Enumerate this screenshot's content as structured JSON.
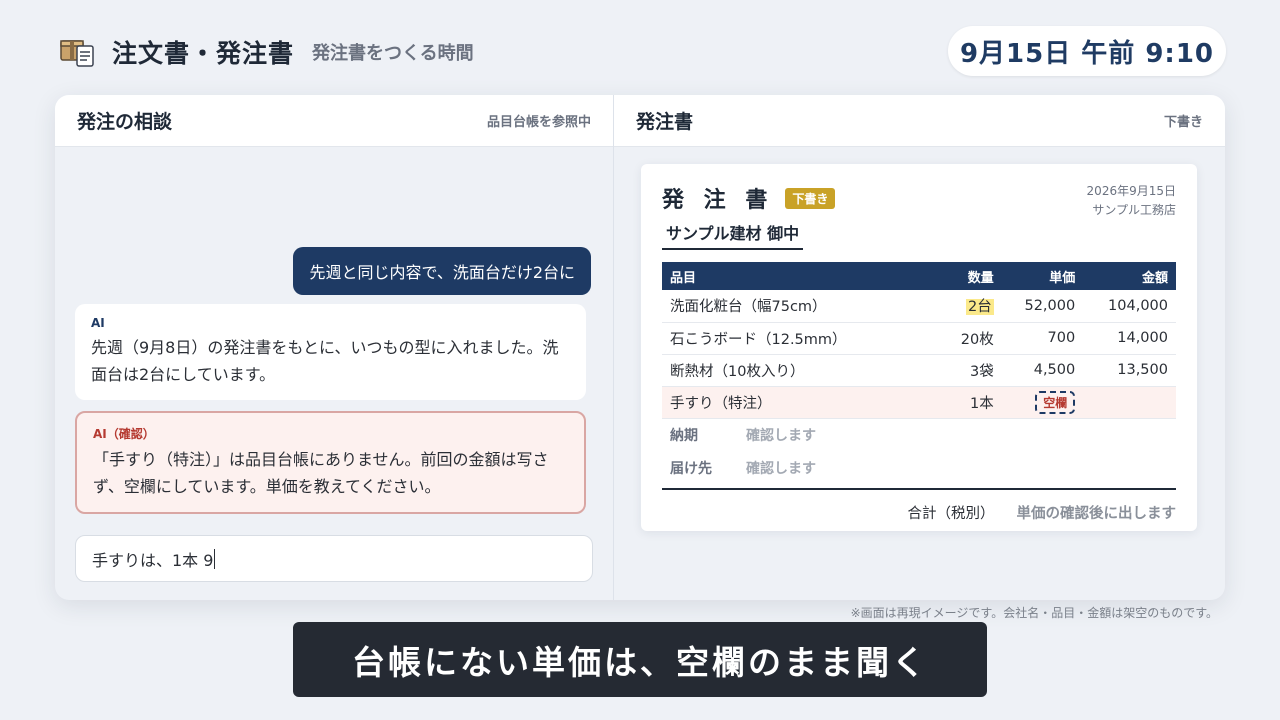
{
  "header": {
    "title": "注文書・発注書",
    "subtitle": "発注書をつくる時間",
    "clock": "9月15日 午前 9:10",
    "icon": "box-document-icon"
  },
  "chat_pane": {
    "title": "発注の相談",
    "hint": "品目台帳を参照中",
    "user_message": "先週と同じ内容で、洗面台だけ2台に",
    "ai_message": {
      "tag": "AI",
      "text": "先週（9月8日）の発注書をもとに、いつもの型に入れました。洗面台は2台にしています。"
    },
    "ai_confirm": {
      "tag": "AI（確認）",
      "text": "「手すり（特注）」は品目台帳にありません。前回の金額は写さず、空欄にしています。単価を教えてください。"
    },
    "input_value": "手すりは、1本 9"
  },
  "doc_pane": {
    "title": "発注書",
    "hint": "下書き",
    "doc": {
      "title": "発 注 書",
      "badge": "下書き",
      "recipient": "サンプル建材 御中",
      "date": "2026年9月15日",
      "issuer": "サンプル工務店",
      "columns": [
        "品目",
        "数量",
        "単価",
        "金額"
      ],
      "rows": [
        {
          "item": "洗面化粧台（幅75cm）",
          "qty": "2台",
          "price": "52,000",
          "amount": "104,000"
        },
        {
          "item": "石こうボード（12.5mm）",
          "qty": "20枚",
          "price": "700",
          "amount": "14,000"
        },
        {
          "item": "断熱材（10枚入り）",
          "qty": "3袋",
          "price": "4,500",
          "amount": "13,500"
        },
        {
          "item": "手すり（特注）",
          "qty": "1本",
          "price": "空欄",
          "amount": ""
        }
      ],
      "delivery_label": "納期",
      "delivery_value": "確認します",
      "destination_label": "届け先",
      "destination_value": "確認します",
      "total_label": "合計（税別）",
      "total_value": "単価の確認後に出します"
    }
  },
  "footer": {
    "disclaimer": "※画面は再現イメージです。会社名・品目・金額は架空のものです。",
    "caption": "台帳にない単価は、空欄のまま聞く"
  },
  "colors": {
    "navy": "#1e3a64",
    "draft_badge": "#c9a227",
    "warn_border": "#d9a6a3",
    "warn_bg": "#fdf1ef",
    "highlight": "#fbe98a"
  }
}
